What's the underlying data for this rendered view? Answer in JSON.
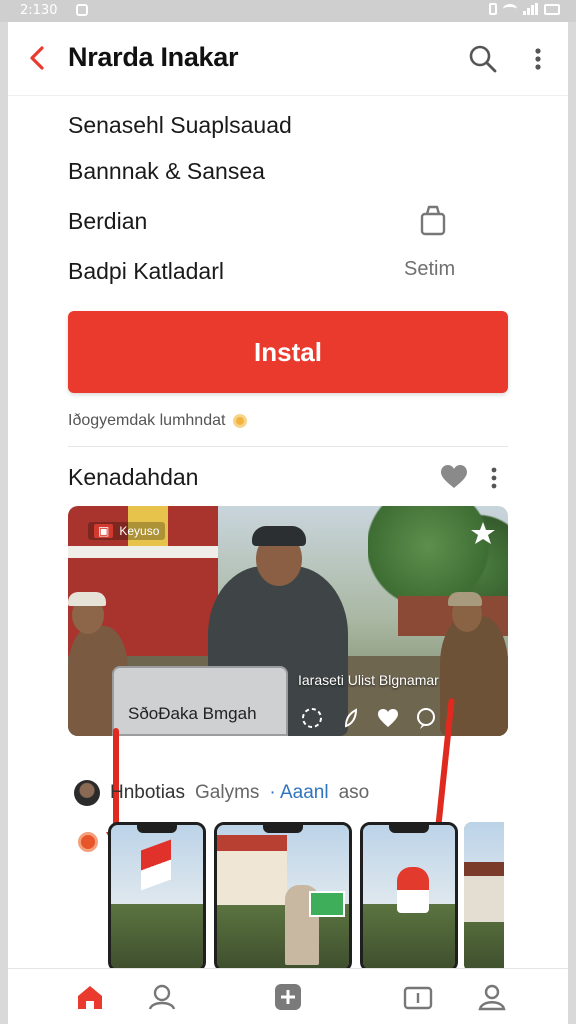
{
  "status_bar": {
    "time": "2:130"
  },
  "app_bar": {
    "title": "Nrarda Inakar"
  },
  "details": {
    "line1": "Senasehl Suaplsauad",
    "line2": "Bannnak & Sansea",
    "line3": "Berdian",
    "line4": "Badpi Katladarl",
    "line4_right": "Setim"
  },
  "install": {
    "label": "Instal"
  },
  "note": {
    "text": "Iðogyemdak lumhndat"
  },
  "section": {
    "title": "Kenadahdan"
  },
  "hero": {
    "tag": "Keyuso",
    "laptop_text": "SðoÐaka Bmgah",
    "overlay_text": "Iaraseti Ulist Blgnamar"
  },
  "post": {
    "author": "Hnbotias",
    "meta": "Galyms",
    "link": "· Aaanl",
    "suffix": "aso"
  },
  "colors": {
    "accent": "#e93a2d",
    "link": "#2f74c0"
  },
  "icons": [
    "back-icon",
    "search-icon",
    "more-icon",
    "cart-icon",
    "heart-icon",
    "star-icon",
    "home-icon",
    "search-nav-icon",
    "add-icon",
    "tv-icon",
    "profile-icon"
  ]
}
